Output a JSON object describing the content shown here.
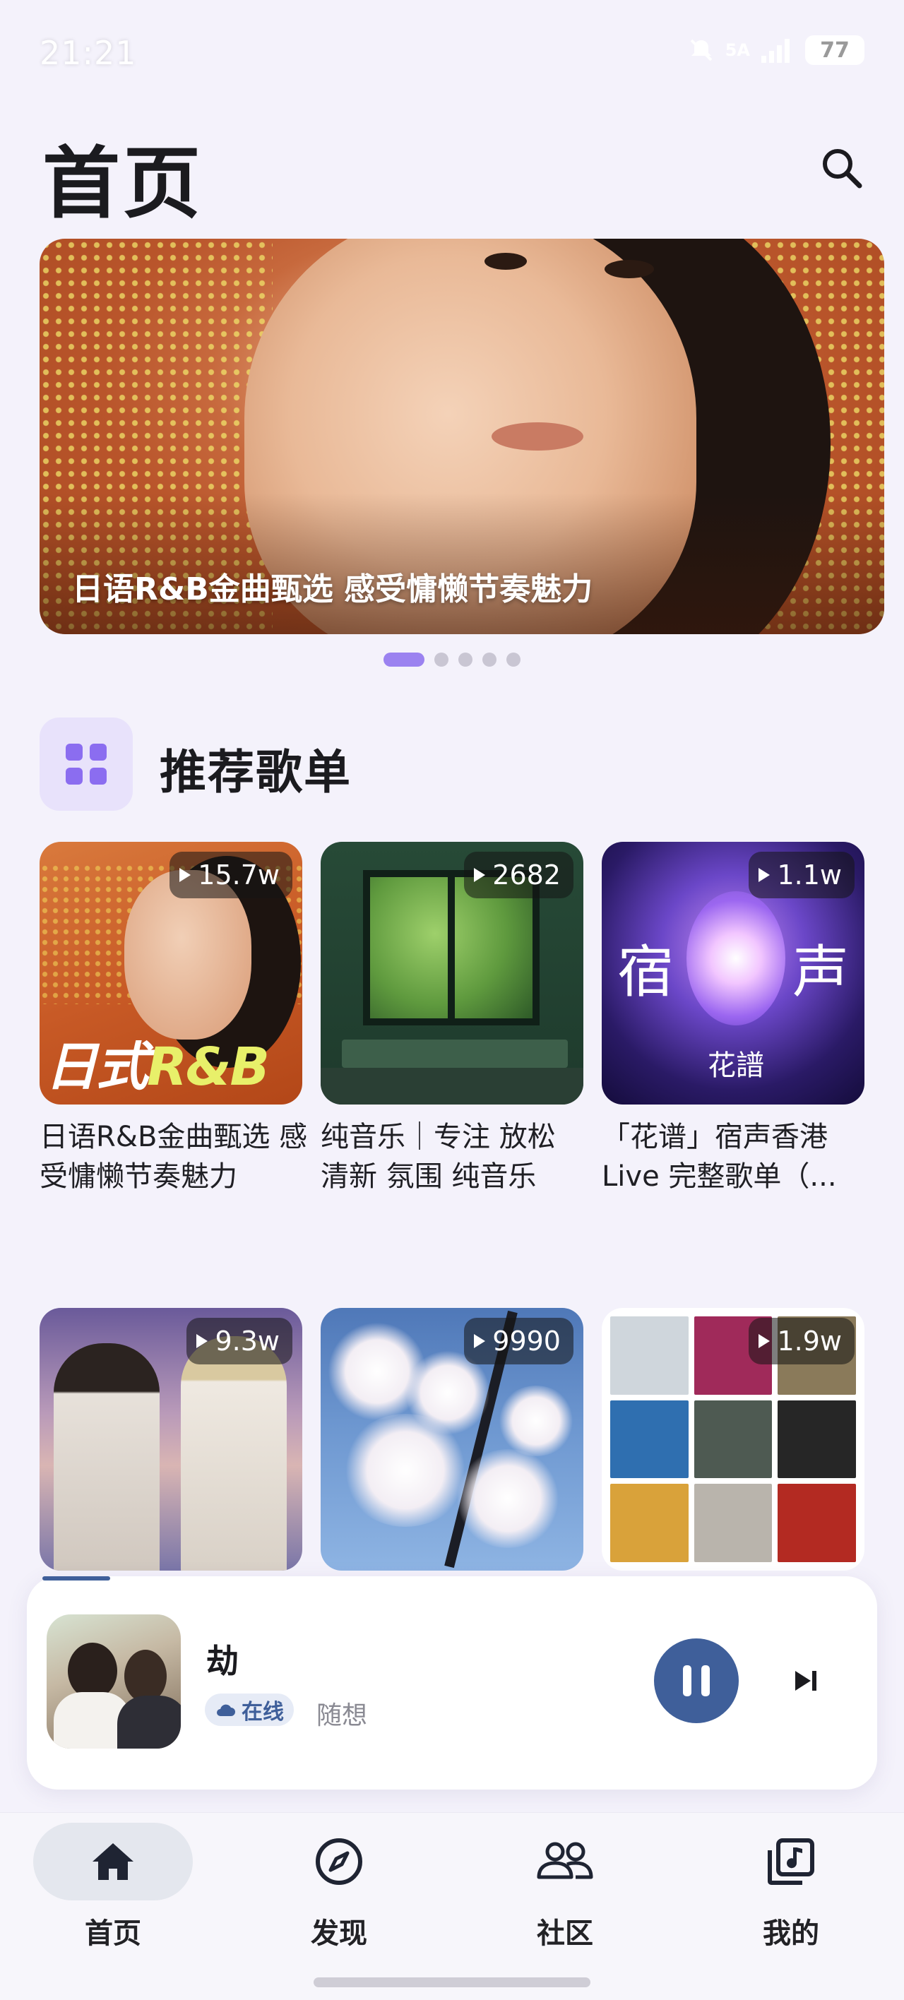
{
  "status_bar": {
    "time": "21:21",
    "network": "5A",
    "battery": "77"
  },
  "header": {
    "title": "首页"
  },
  "banner": {
    "caption": "日语R&B金曲甄选 感受慵懒节奏魅力",
    "page_count": 5,
    "active_page": 1
  },
  "section": {
    "title": "推荐歌单"
  },
  "playlists": [
    {
      "plays": "15.7w",
      "title": "日语R&B金曲甄选 感受慵懒节奏魅力",
      "cover_text_a": "日式",
      "cover_text_b": "R&B"
    },
    {
      "plays": "2682",
      "title": "纯音乐｜专注 放松 清新 氛围 纯音乐"
    },
    {
      "plays": "1.1w",
      "title": "「花谱」宿声香港 Live 完整歌单（...",
      "cover_text_a": "宿",
      "cover_text_b": "声",
      "cover_text_c": "花譜"
    },
    {
      "plays": "9.3w"
    },
    {
      "plays": "9990"
    },
    {
      "plays": "1.9w"
    }
  ],
  "now_playing": {
    "title": "劫",
    "source": "在线",
    "artist": "随想",
    "progress": 0.08
  },
  "tabs": [
    {
      "label": "首页",
      "icon": "home-icon",
      "active": true
    },
    {
      "label": "发现",
      "icon": "compass-icon",
      "active": false
    },
    {
      "label": "社区",
      "icon": "people-icon",
      "active": false
    },
    {
      "label": "我的",
      "icon": "music-library-icon",
      "active": false
    }
  ],
  "colors": {
    "accent": "#9b82f0",
    "player_accent": "#3f5f9a",
    "background": "#f4f2fb"
  }
}
